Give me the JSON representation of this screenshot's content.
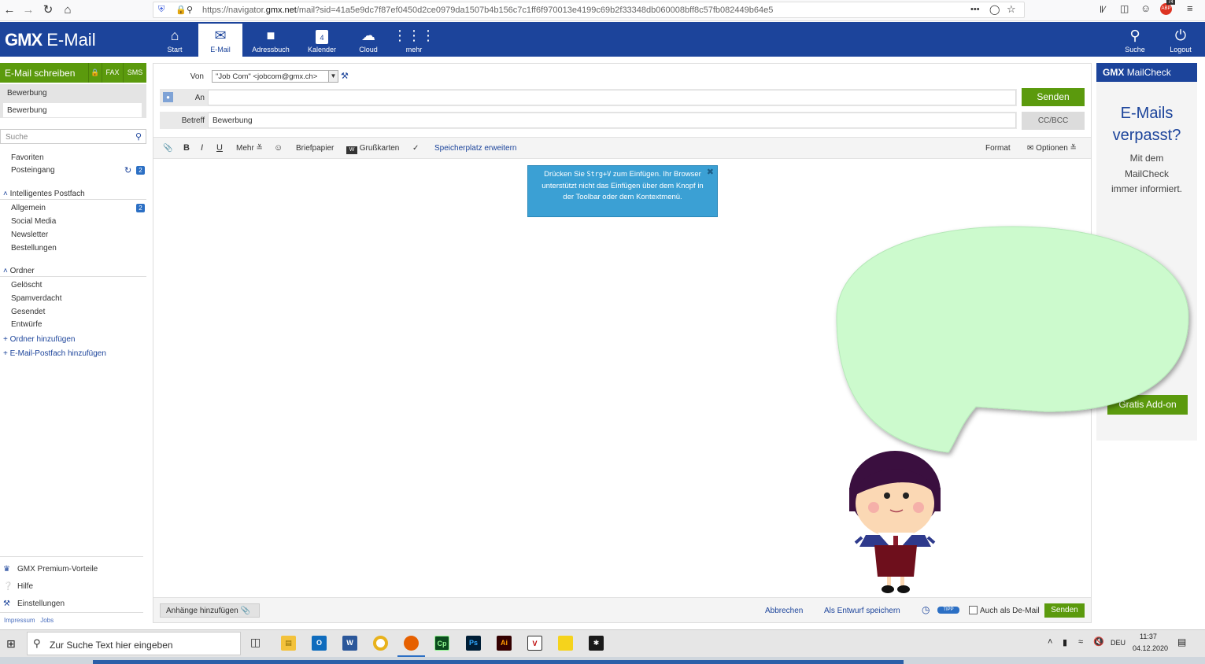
{
  "browser": {
    "url_host_prefix": "https://navigator.",
    "url_host": "gmx.net",
    "url_path": "/mail?sid=41a5e9dc7f87ef0450d2ce0979da1507b4b156c7c1ff6f970013e4199c69b2f33348db060008bff8c57fb082449b64e5",
    "ext_badge": "74",
    "more_label": "•••"
  },
  "header": {
    "logo_brand": "GMX",
    "logo_product": "E-Mail",
    "nav": [
      {
        "label": "Start",
        "icon": "home-icon"
      },
      {
        "label": "E-Mail",
        "icon": "envelope-icon"
      },
      {
        "label": "Adressbuch",
        "icon": "addressbook-icon"
      },
      {
        "label": "Kalender",
        "icon": "calendar-icon"
      },
      {
        "label": "Cloud",
        "icon": "cloud-icon"
      },
      {
        "label": "mehr",
        "icon": "grid-icon"
      }
    ],
    "calendar_day": "4",
    "search_label": "Suche",
    "logout_label": "Logout"
  },
  "sidebar": {
    "compose_label": "E-Mail schreiben",
    "fax_label": "FAX",
    "sms_label": "SMS",
    "draft_title": "Bewerbung",
    "draft_tab": "Bewerbung",
    "search_placeholder": "Suche",
    "favorites_label": "Favoriten",
    "inbox_label": "Posteingang",
    "inbox_count": "2",
    "smart_section": "Intelligentes Postfach",
    "smart_items": [
      "Allgemein",
      "Social Media",
      "Newsletter",
      "Bestellungen"
    ],
    "general_count": "2",
    "folders_section": "Ordner",
    "folder_items": [
      "Gelöscht",
      "Spamverdacht",
      "Gesendet",
      "Entwürfe"
    ],
    "add_folder": "Ordner hinzufügen",
    "add_mailbox": "E-Mail-Postfach hinzufügen",
    "footer_items": [
      "GMX Premium-Vorteile",
      "Hilfe",
      "Einstellungen"
    ],
    "legal_links": "Impressum   Jobs"
  },
  "compose": {
    "from_label": "Von",
    "from_value": "\"Job Com\" <jobcom@gmx.ch>",
    "to_label": "An",
    "to_value": "",
    "subject_label": "Betreff",
    "subject_value": "Bewerbung",
    "send_label": "Senden",
    "ccbcc_label": "CC/BCC",
    "toolbar": {
      "bold": "B",
      "italic": "I",
      "underline": "U",
      "more": "Mehr ≚",
      "stationery": "Briefpapier",
      "greeting_cards": "Grußkarten",
      "storage_link": "Speicherplatz erweitern",
      "format": "Format",
      "options": "Optionen ≚"
    },
    "notice_line1_pre": "Drücken Sie ",
    "notice_key": "Strg+V",
    "notice_line1_post": " zum Einfügen. Ihr Browser unterstützt nicht das Einfügen über dem Knopf in der Toolbar oder dem Kontextmenü.",
    "bottom": {
      "attach_label": "Anhänge hinzufügen",
      "cancel_label": "Abbrechen",
      "draft_label": "Als Entwurf speichern",
      "tip_label": "TIPP",
      "demail_label": "Auch als De-Mail",
      "send_label": "Senden"
    }
  },
  "mailcheck": {
    "header_brand": "GMX",
    "header_product": "MailCheck",
    "title_line1": "E-Mails",
    "title_line2": "verpasst?",
    "sub_line1": "Mit dem",
    "sub_line2": "MailCheck",
    "sub_line3": "immer informiert.",
    "addon_label": "Gratis Add-on"
  },
  "taskbar": {
    "search_placeholder": "Zur Suche Text hier eingeben",
    "lang": "DEU",
    "time": "11:37",
    "date": "04.12.2020",
    "apps": [
      {
        "name": "word-app",
        "label": "W",
        "color": "#2b579a"
      },
      {
        "name": "chrome-app",
        "label": "",
        "color": "#e8b21c"
      },
      {
        "name": "firefox-app",
        "label": "",
        "color": "#e66000"
      },
      {
        "name": "captivate-app",
        "label": "Cp",
        "color": "#0b4b1d"
      },
      {
        "name": "photoshop-app",
        "label": "Ps",
        "color": "#001e36"
      },
      {
        "name": "illustrator-app",
        "label": "Ai",
        "color": "#330000"
      },
      {
        "name": "vnc-app",
        "label": "V",
        "color": "#ffffff"
      },
      {
        "name": "notes-app",
        "label": "",
        "color": "#f5d31c"
      },
      {
        "name": "acrobat-app",
        "label": "",
        "color": "#1a1a1a"
      }
    ]
  },
  "colors": {
    "brand_blue": "#1c449b",
    "green": "#5b9a0d",
    "notice_blue": "#3ba0d4",
    "bubble_green": "#ccfacd"
  }
}
